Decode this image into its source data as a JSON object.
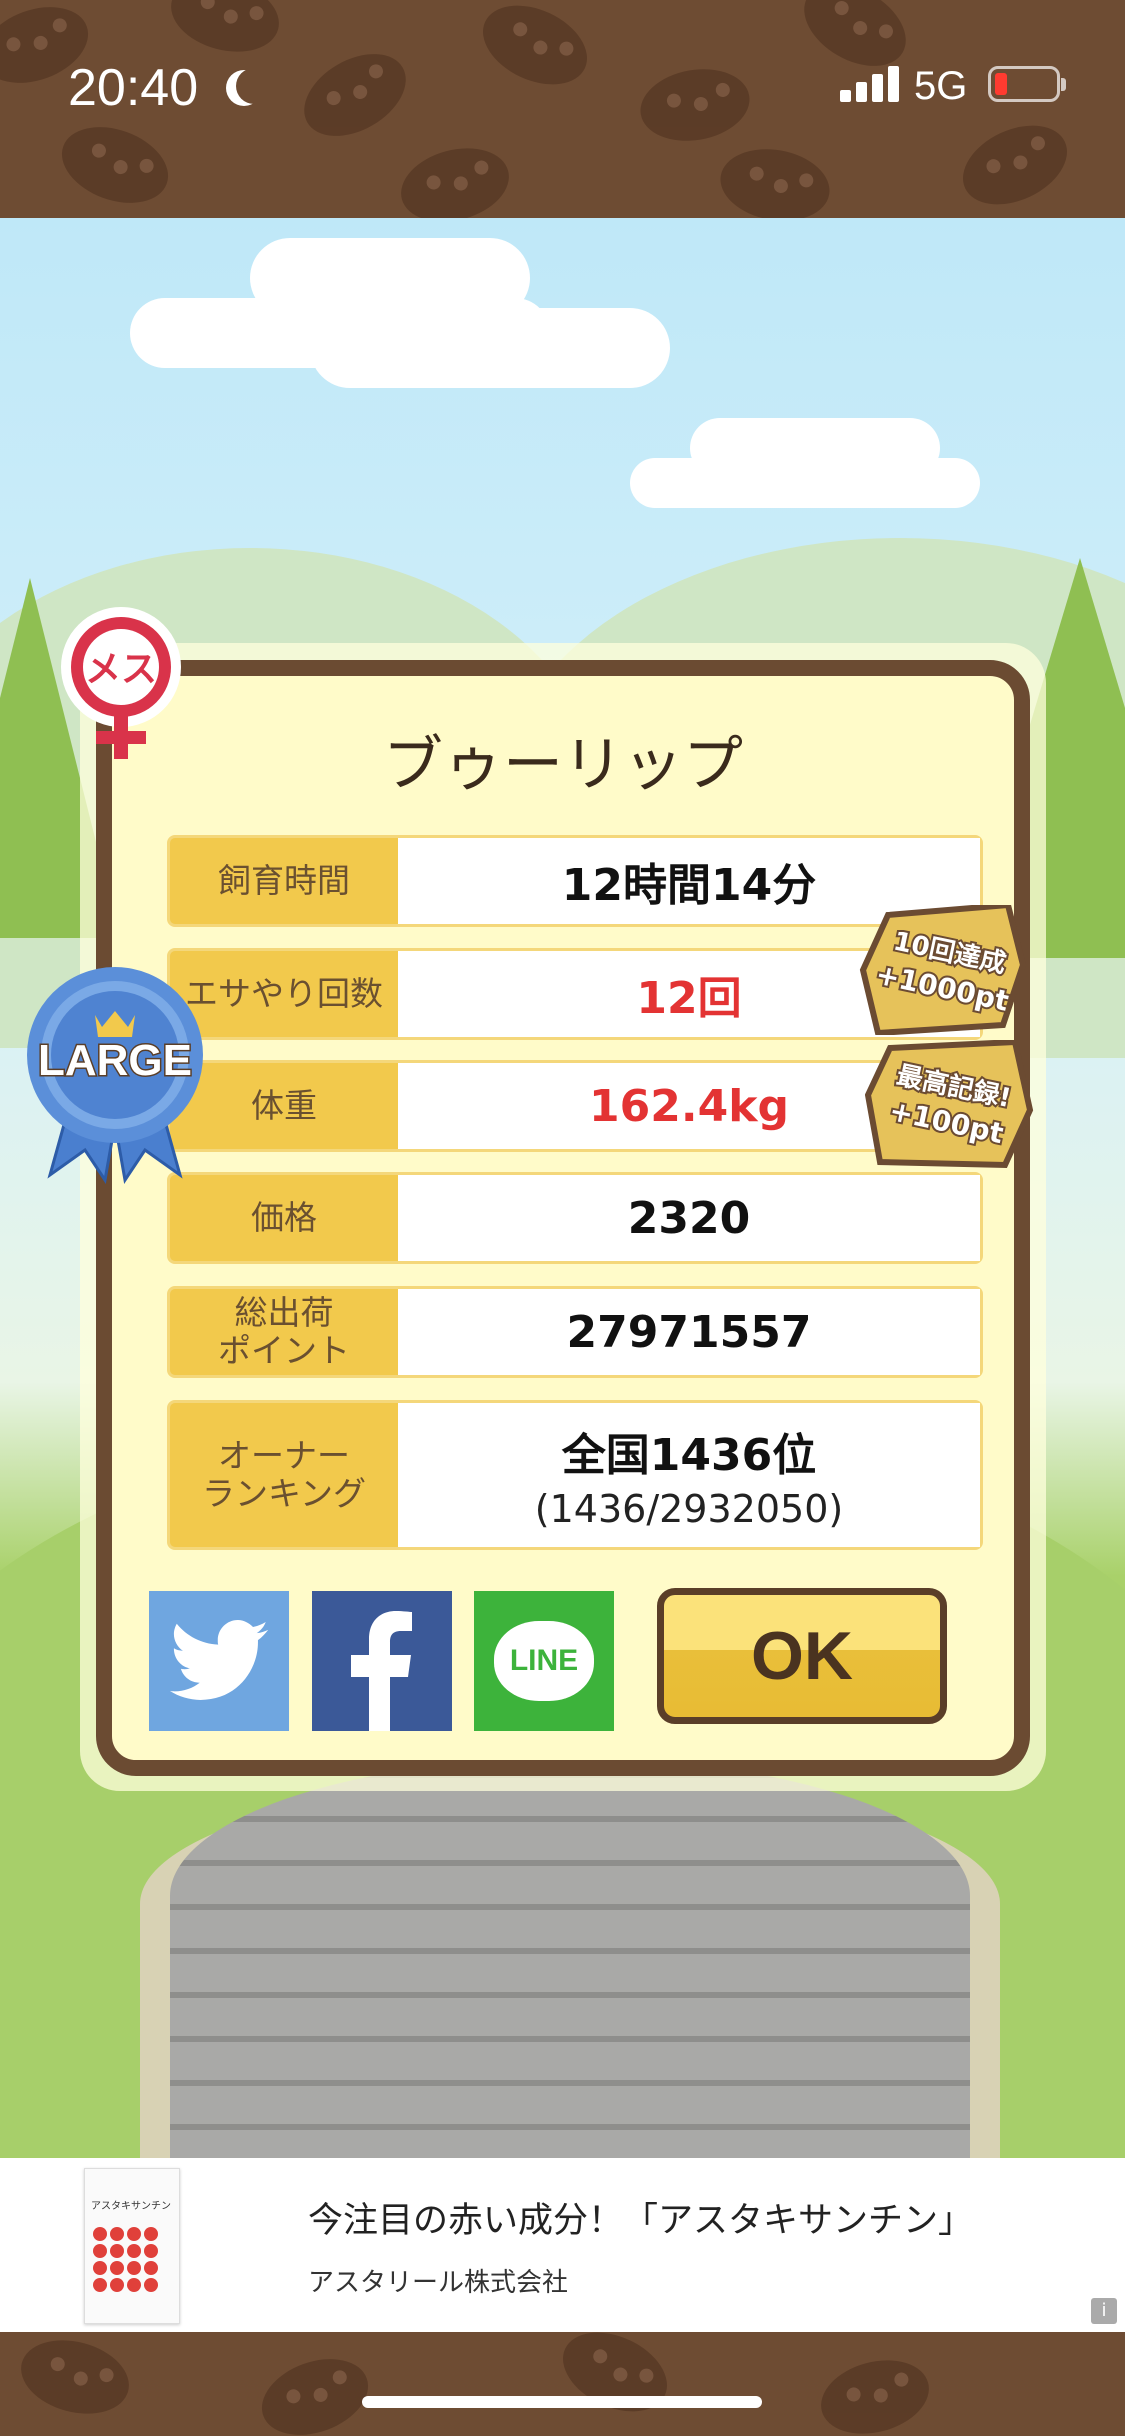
{
  "status_bar": {
    "time": "20:40",
    "network": "5G"
  },
  "dialog": {
    "title": "ブゥーリップ",
    "gender_badge": "メス",
    "size_ribbon": "LARGE",
    "rows": [
      {
        "label": "飼育時間",
        "value": "12時間14分",
        "highlight": false
      },
      {
        "label": "エサやり回数",
        "value": "12回",
        "highlight": true
      },
      {
        "label": "体重",
        "value": "162.4kg",
        "highlight": true
      },
      {
        "label": "価格",
        "value": "2320",
        "highlight": false
      },
      {
        "label": "総出荷\nポイント",
        "value": "27971557",
        "highlight": false
      },
      {
        "label": "オーナー\nランキング",
        "value": "全国1436位",
        "sub": "(1436/2932050)",
        "highlight": false
      }
    ],
    "bonus_badges": [
      {
        "line1": "10回達成",
        "line2": "+1000pt"
      },
      {
        "line1": "最高記録!",
        "line2": "+100pt"
      }
    ],
    "share": {
      "twitter": "twitter-icon",
      "facebook": "facebook-icon",
      "line_label": "LINE"
    },
    "ok_label": "OK"
  },
  "ad": {
    "title": "今注目の赤い成分！「アスタキサンチン」",
    "advertiser": "アスタリール株式会社",
    "product_label": "アスタキサンチン",
    "info_label": "i"
  },
  "colors": {
    "brown": "#6b4b32",
    "cream": "#fffbc9",
    "gold": "#f2c94c",
    "red": "#e33333",
    "twitter": "#6fa6e0",
    "facebook": "#3b5998",
    "line": "#3db33b"
  }
}
